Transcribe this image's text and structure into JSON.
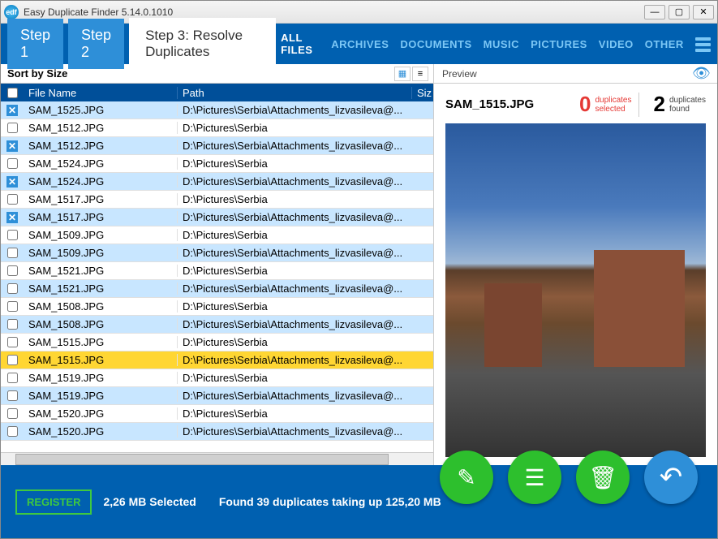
{
  "title": "Easy Duplicate Finder 5.14.0.1010",
  "steps": {
    "s1": "Step 1",
    "s2": "Step 2",
    "s3": "Step 3: Resolve Duplicates"
  },
  "nav": {
    "all": "ALL FILES",
    "archives": "ARCHIVES",
    "documents": "DOCUMENTS",
    "music": "MUSIC",
    "pictures": "PICTURES",
    "video": "VIDEO",
    "other": "OTHER"
  },
  "sort_label": "Sort by Size",
  "preview_label": "Preview",
  "columns": {
    "name": "File Name",
    "path": "Path",
    "size": "Siz"
  },
  "paths": {
    "short": "D:\\Pictures\\Serbia",
    "long": "D:\\Pictures\\Serbia\\Attachments_lizvasileva@..."
  },
  "rows": [
    {
      "name": "SAM_1525.JPG",
      "path_key": "long",
      "blue": true,
      "x": true
    },
    {
      "name": "SAM_1512.JPG",
      "path_key": "short",
      "blue": false,
      "x": false
    },
    {
      "name": "SAM_1512.JPG",
      "path_key": "long",
      "blue": true,
      "x": true
    },
    {
      "name": "SAM_1524.JPG",
      "path_key": "short",
      "blue": false,
      "x": false
    },
    {
      "name": "SAM_1524.JPG",
      "path_key": "long",
      "blue": true,
      "x": true
    },
    {
      "name": "SAM_1517.JPG",
      "path_key": "short",
      "blue": false,
      "x": false
    },
    {
      "name": "SAM_1517.JPG",
      "path_key": "long",
      "blue": true,
      "x": true
    },
    {
      "name": "SAM_1509.JPG",
      "path_key": "short",
      "blue": false,
      "x": false
    },
    {
      "name": "SAM_1509.JPG",
      "path_key": "long",
      "blue": true,
      "x": false
    },
    {
      "name": "SAM_1521.JPG",
      "path_key": "short",
      "blue": false,
      "x": false
    },
    {
      "name": "SAM_1521.JPG",
      "path_key": "long",
      "blue": true,
      "x": false
    },
    {
      "name": "SAM_1508.JPG",
      "path_key": "short",
      "blue": false,
      "x": false
    },
    {
      "name": "SAM_1508.JPG",
      "path_key": "long",
      "blue": true,
      "x": false
    },
    {
      "name": "SAM_1515.JPG",
      "path_key": "short",
      "blue": false,
      "x": false
    },
    {
      "name": "SAM_1515.JPG",
      "path_key": "long",
      "blue": false,
      "x": false,
      "selected": true
    },
    {
      "name": "SAM_1519.JPG",
      "path_key": "short",
      "blue": false,
      "x": false
    },
    {
      "name": "SAM_1519.JPG",
      "path_key": "long",
      "blue": true,
      "x": false
    },
    {
      "name": "SAM_1520.JPG",
      "path_key": "short",
      "blue": false,
      "x": false
    },
    {
      "name": "SAM_1520.JPG",
      "path_key": "long",
      "blue": true,
      "x": false
    }
  ],
  "preview": {
    "filename": "SAM_1515.JPG",
    "dup_sel_num": "0",
    "dup_sel_text1": "duplicates",
    "dup_sel_text2": "selected",
    "dup_found_num": "2",
    "dup_found_text1": "duplicates",
    "dup_found_text2": "found"
  },
  "footer": {
    "register": "REGISTER",
    "selected": "2,26 MB Selected",
    "found": "Found 39 duplicates taking up 125,20 MB"
  }
}
